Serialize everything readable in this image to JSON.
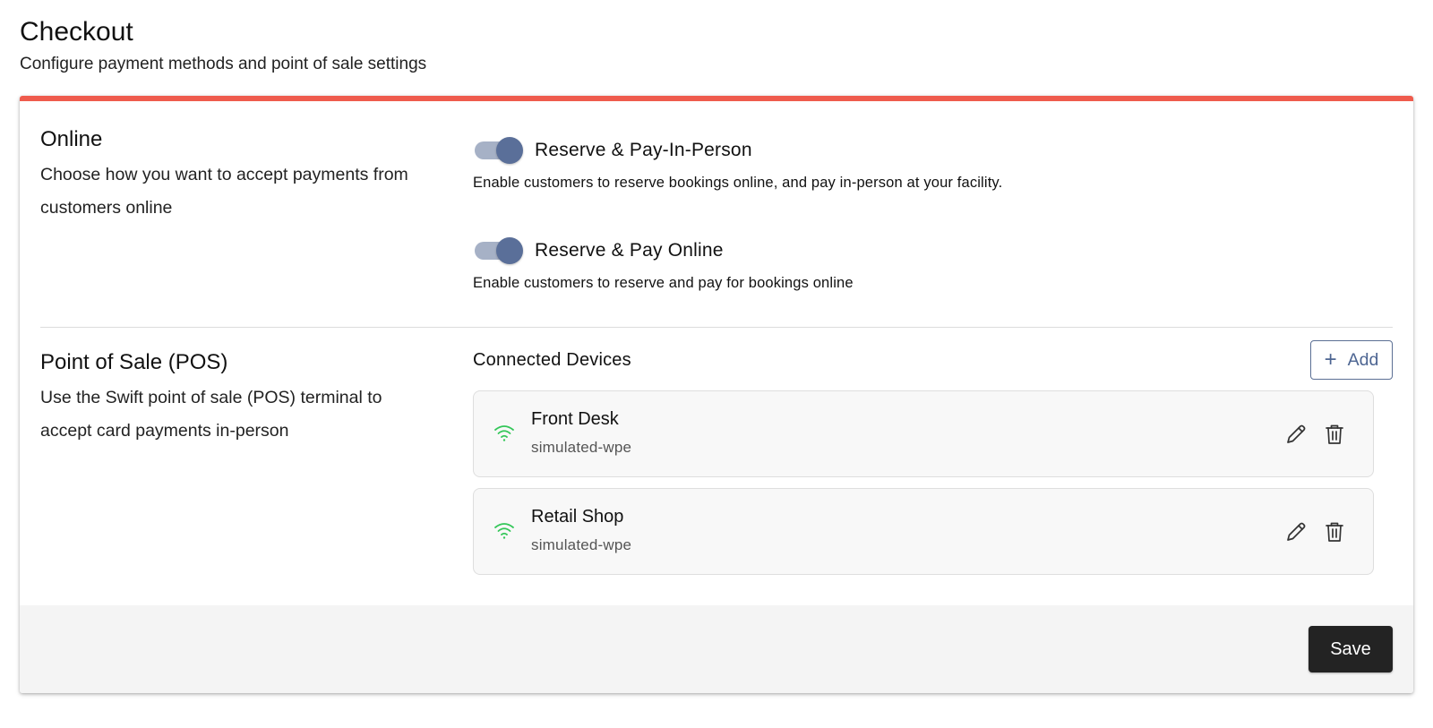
{
  "page": {
    "title": "Checkout",
    "subtitle": "Configure payment methods and point of sale settings"
  },
  "colors": {
    "accent_bar": "#ef5b4d",
    "toggle_track": "#a6b1c6",
    "toggle_knob": "#5a6f99",
    "wifi_connected": "#34c759",
    "save_button": "#232323"
  },
  "online": {
    "heading": "Online",
    "description": "Choose how you want to accept payments from customers online",
    "options": [
      {
        "label": "Reserve & Pay-In-Person",
        "description": "Enable customers to reserve bookings online, and pay in-person at your facility.",
        "enabled": true
      },
      {
        "label": "Reserve & Pay Online",
        "description": "Enable customers to reserve and pay for bookings online",
        "enabled": true
      }
    ]
  },
  "pos": {
    "heading": "Point of Sale (POS)",
    "description": "Use the Swift point of sale (POS) terminal to accept card payments in-person",
    "devices_title": "Connected Devices",
    "add_label": "Add",
    "add_icon": "plus-icon",
    "devices": [
      {
        "name": "Front Desk",
        "id": "simulated-wpe",
        "status_icon": "wifi-icon"
      },
      {
        "name": "Retail Shop",
        "id": "simulated-wpe",
        "status_icon": "wifi-icon"
      }
    ]
  },
  "footer": {
    "save_label": "Save"
  }
}
